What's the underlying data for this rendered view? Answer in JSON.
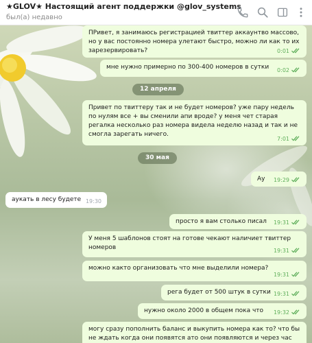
{
  "header": {
    "title": "★GLOV★ Настоящий агент поддержки @glov_systems",
    "status": "был(а) недавно"
  },
  "icons": [
    "phone-icon",
    "search-icon",
    "sidebar-toggle-icon",
    "more-vertical-icon",
    "double-check-icon"
  ],
  "colors": {
    "outgoing_bubble": "#effdde",
    "incoming_bubble": "#ffffff",
    "read_ticks": "#5fae5b",
    "date_pill": "#6e7d5f"
  },
  "messages": [
    {
      "direction": "out",
      "text": "ПРивет, я занимаюсь регистрацией твиттер аккаунтво массово, но у вас постоянно номера улетают быстро, можно ли как то их зарезервировать?",
      "time": "0:01"
    },
    {
      "direction": "out",
      "text": "мне нужно примерно по 300-400 номеров в сутки",
      "time": "0:02"
    },
    {
      "direction": "date",
      "text": "12 апреля"
    },
    {
      "direction": "out",
      "text": "Привет по твиттеру так и не будет номеров? уже пару недель по нулям все + вы сменили апи вроде? у меня чет старая регалка несколько раз номера видела неделю назад и так и не смогла зарегать ничего.",
      "time": "7:01"
    },
    {
      "direction": "date",
      "text": "30 мая"
    },
    {
      "direction": "out",
      "text": "Ау",
      "time": "19:29"
    },
    {
      "direction": "in",
      "text": "аукать в лесу будете",
      "time": "19:30"
    },
    {
      "direction": "out",
      "text": "просто я вам столько писал",
      "time": "19:31"
    },
    {
      "direction": "out",
      "text": "У меня 5 шаблонов стоят на готове чекают наличиет твиттер номеров",
      "time": "19:31"
    },
    {
      "direction": "out",
      "text": "можно както организовать что мне выделили номера?",
      "time": "19:31"
    },
    {
      "direction": "out",
      "text": "рега будет от 500 штук в сутки",
      "time": "19:31"
    },
    {
      "direction": "out",
      "text": "нужно около 2000 в общем пока что",
      "time": "19:32"
    },
    {
      "direction": "out",
      "text": "могу сразу пополнить баланс и выкупить номера как то? что бы не ждать когда они появятся ато они появляются и через час",
      "time": ""
    }
  ]
}
